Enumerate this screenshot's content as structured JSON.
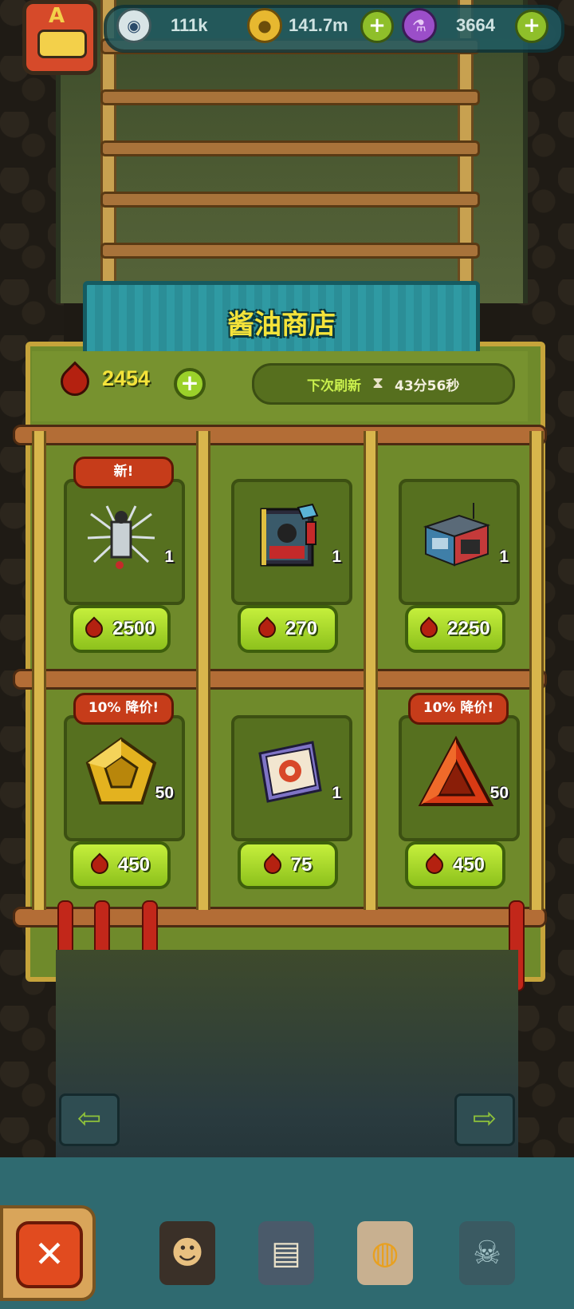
{
  "hud": {
    "eyes": "111k",
    "coins": "141.7m",
    "potions": "3664",
    "avatar_letter": "A"
  },
  "shop": {
    "title": "酱油商店",
    "balance": "2454",
    "refresh_label": "下次刷新",
    "refresh_time": "43分56秒",
    "items": [
      {
        "badge": "新!",
        "qty": "1",
        "price": "2500",
        "art": "spiky-creature"
      },
      {
        "badge": "",
        "qty": "1",
        "price": "270",
        "art": "portrait-card"
      },
      {
        "badge": "",
        "qty": "1",
        "price": "2250",
        "art": "shop-building"
      },
      {
        "badge": "10% 降价!",
        "qty": "50",
        "price": "450",
        "art": "gold-pentagon-gem"
      },
      {
        "badge": "",
        "qty": "1",
        "price": "75",
        "art": "scroll-map"
      },
      {
        "badge": "10% 降价!",
        "qty": "50",
        "price": "450",
        "art": "red-triangle-gem"
      }
    ]
  },
  "colors": {
    "accent_yellow": "#f4e33a",
    "button_green": "#9bd12a",
    "badge_red": "#c63c1a",
    "drop_red": "#b42110"
  },
  "bottom": {
    "close_glyph": "✕"
  }
}
